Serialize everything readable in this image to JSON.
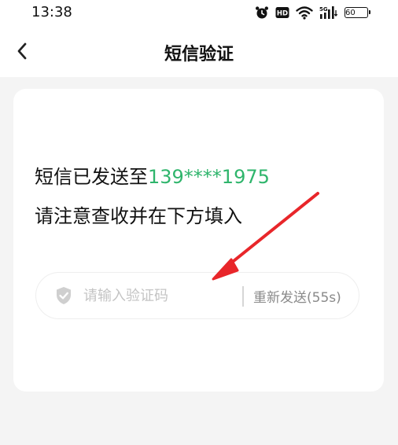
{
  "status_bar": {
    "time": "13:38",
    "network": "5G",
    "battery": "60",
    "icons": [
      "alarm-icon",
      "hd-icon",
      "wifi-icon",
      "signal-icon",
      "battery-icon"
    ]
  },
  "nav": {
    "title": "短信验证",
    "back_icon": "chevron-left-icon"
  },
  "message": {
    "line1_prefix": "短信已发送至",
    "phone": "139****1975",
    "line2": "请注意查收并在下方填入"
  },
  "code_input": {
    "placeholder": "请输入验证码",
    "value": "",
    "icon": "shield-check-icon"
  },
  "resend": {
    "label": "重新发送(55s)"
  },
  "annotation": {
    "arrow_color": "#e8262a"
  },
  "colors": {
    "accent": "#2fb56c",
    "background": "#f4f4f4",
    "card": "#ffffff"
  }
}
